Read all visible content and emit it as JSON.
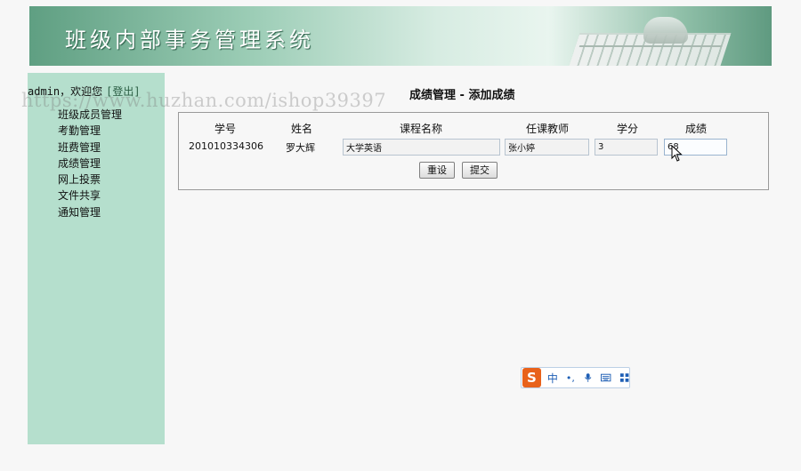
{
  "banner": {
    "title": "班级内部事务管理系统"
  },
  "sidebar": {
    "user": "admin，欢迎您",
    "logout": "[登出]",
    "items": [
      {
        "label": "班级成员管理"
      },
      {
        "label": "考勤管理"
      },
      {
        "label": "班费管理"
      },
      {
        "label": "成绩管理"
      },
      {
        "label": "网上投票"
      },
      {
        "label": "文件共享"
      },
      {
        "label": "通知管理"
      }
    ]
  },
  "watermark": "https://www.huzhan.com/ishop39397",
  "main": {
    "heading": "成绩管理 - 添加成绩",
    "columns": [
      "学号",
      "姓名",
      "课程名称",
      "任课教师",
      "学分",
      "成绩"
    ],
    "row": {
      "student_id": "201010334306",
      "name": "罗大辉",
      "course": "大学英语",
      "teacher": "张小婷",
      "credit": "3",
      "score": "68"
    },
    "buttons": {
      "reset": "重设",
      "submit": "提交"
    }
  },
  "ime": {
    "logo": "S",
    "mode": "中",
    "punctuation": "•,",
    "icons": [
      "mic-icon",
      "keyboard-icon",
      "grid-icon"
    ]
  },
  "colors": {
    "sidebar": "#b5dfcd",
    "banner": "#7fb59b",
    "ime_logo": "#e8621b",
    "ime_accent": "#1f5fb5"
  }
}
